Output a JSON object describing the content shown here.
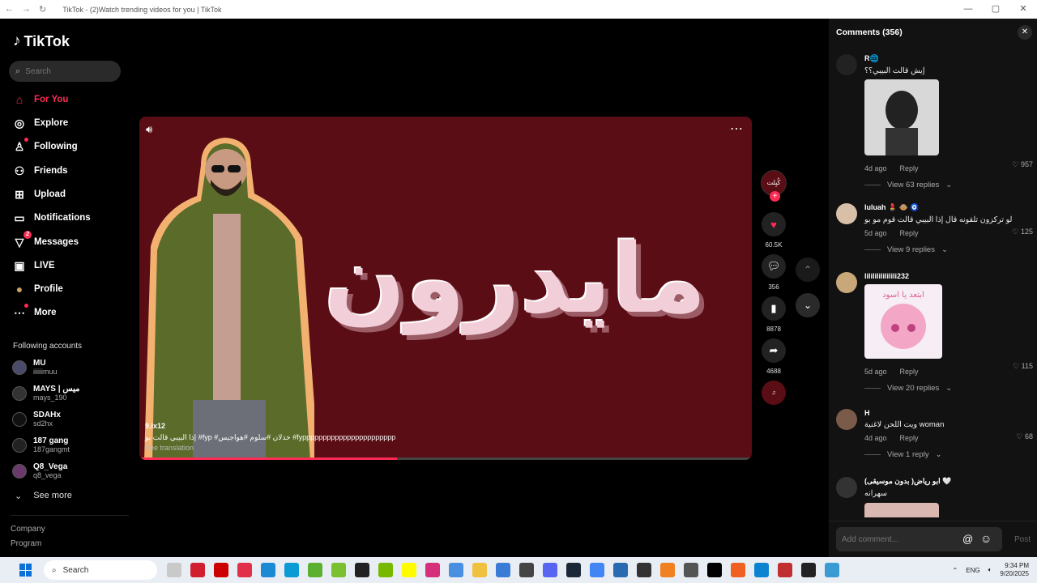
{
  "window": {
    "title": "TikTok - (2)Watch trending videos for you | TikTok",
    "back": "←",
    "forward": "→",
    "reload": "↻",
    "min": "—",
    "max": "▢",
    "close": "✕"
  },
  "brand": {
    "name": "TikTok"
  },
  "search": {
    "placeholder": "Search"
  },
  "nav": [
    {
      "label": "For You",
      "icon": "home-icon"
    },
    {
      "label": "Explore",
      "icon": "compass-icon"
    },
    {
      "label": "Following",
      "icon": "following-icon"
    },
    {
      "label": "Friends",
      "icon": "friends-icon"
    },
    {
      "label": "Upload",
      "icon": "upload-icon"
    },
    {
      "label": "Notifications",
      "icon": "notifications-icon"
    },
    {
      "label": "Messages",
      "icon": "messages-icon",
      "badge": "2"
    },
    {
      "label": "LIVE",
      "icon": "live-icon"
    },
    {
      "label": "Profile",
      "icon": "profile-icon"
    },
    {
      "label": "More",
      "icon": "more-icon"
    }
  ],
  "following_title": "Following accounts",
  "following": [
    {
      "name": "MU",
      "handle": "iiiiiimuu"
    },
    {
      "name": "MAYS | ميس",
      "handle": "mays_190"
    },
    {
      "name": "SDAHx",
      "handle": "sd2hx"
    },
    {
      "name": "187 gang",
      "handle": "187gangmt"
    },
    {
      "name": "Q8_Vega",
      "handle": "q8_vega"
    }
  ],
  "see_more": "See more",
  "footer": [
    "Company",
    "Program"
  ],
  "video": {
    "overlay_text": "مايدرون",
    "author": "9.ix12",
    "caption": "إذا البيبي قالت بو #fyp #خذلان #سلوم #هواجيس #fyppppppppppppppppppppppp",
    "see_translation": "See translation",
    "progress": 0.42,
    "likes": "60.5K",
    "comments": "356",
    "saves": "8878",
    "shares": "4688",
    "author_avatar_text": "كُبِلت"
  },
  "comments_panel": {
    "title": "Comments (356)",
    "items": [
      {
        "user": "R🌐",
        "text": "إيش قالت البيبي؟؟",
        "time": "4d ago",
        "reply": "Reply",
        "likes": "957",
        "replies": "View 63 replies",
        "has_image": true
      },
      {
        "user": "luluah 💄 🐵 🧿",
        "text": "لو تركزون تلقونه قال إذا البيبي قالت قوم مو بو",
        "time": "5d ago",
        "reply": "Reply",
        "likes": "125",
        "replies": "View 9 replies"
      },
      {
        "user": "lililililililili232",
        "text": "",
        "time": "5d ago",
        "reply": "Reply",
        "likes": "115",
        "replies": "View 20 replies",
        "has_image": true,
        "image_text": "ابتعد يا اسود"
      },
      {
        "user": "H",
        "text": "ويت اللحن لاغنية woman",
        "time": "4d ago",
        "reply": "Reply",
        "likes": "68",
        "replies": "View 1 reply"
      },
      {
        "user": "ابو رياض( بدون موسيقى) 🤍",
        "text": "سهرانه",
        "time": "",
        "reply": "",
        "likes": ""
      }
    ],
    "add_placeholder": "Add comment...",
    "post": "Post"
  },
  "taskbar": {
    "search": "Search",
    "lang": "ENG",
    "time": "9:34 PM",
    "date": "9/20/2025"
  },
  "colors": {
    "accent": "#fe2c55",
    "video_bg": "#5a0d14"
  }
}
